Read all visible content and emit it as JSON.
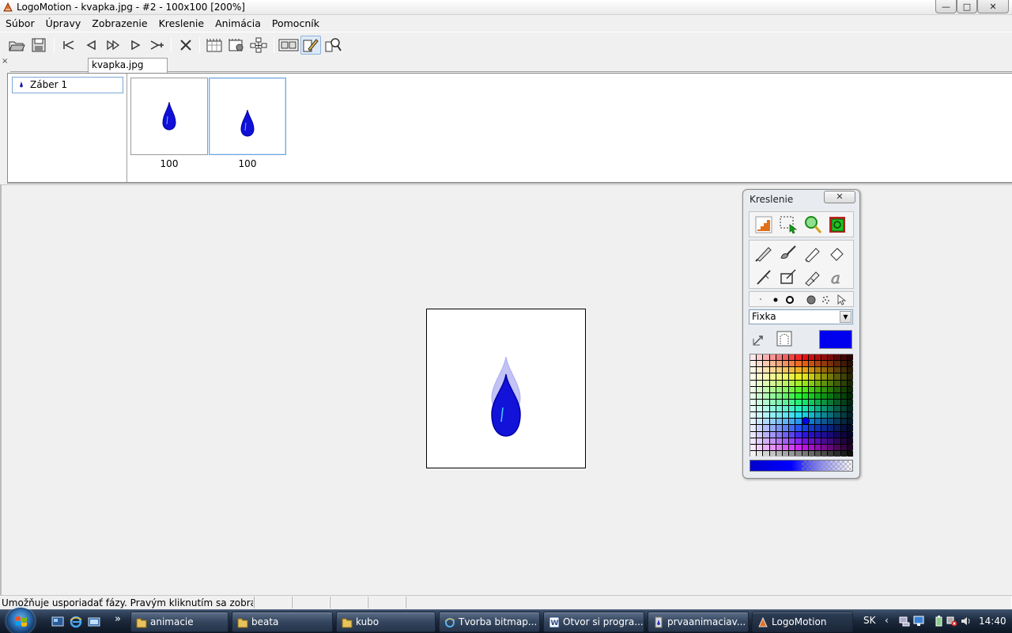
{
  "window": {
    "title": "LogoMotion - kvapka.jpg - #2 - 100x100 [200%]",
    "minimize_label": "—",
    "maximize_label": "□",
    "close_label": "✕"
  },
  "menubar": {
    "items": [
      "Súbor",
      "Úpravy",
      "Zobrazenie",
      "Kreslenie",
      "Animácia",
      "Pomocník"
    ]
  },
  "toolbar": {
    "icons": [
      "open-icon",
      "save-icon",
      "first-frame-icon",
      "prev-frame-icon",
      "next-frames-icon",
      "play-icon",
      "last-frame-icon",
      "delete-frame-icon",
      "frame-grid-icon",
      "frame-image-icon",
      "move-icon",
      "frames-view-icon",
      "draw-icon",
      "zoom-icon"
    ]
  },
  "tabs": {
    "close_label": "×",
    "active_tab": "kvapka.jpg"
  },
  "scenes": {
    "items": [
      {
        "label": "Záber 1"
      }
    ]
  },
  "frames": [
    {
      "label": "100",
      "selected": false
    },
    {
      "label": "100",
      "selected": true
    }
  ],
  "drawing_panel": {
    "title": "Kreslenie",
    "close_label": "✕",
    "brush_type": "Fixka",
    "current_color": "#0000ee",
    "dropdown_arrow": "▼"
  },
  "statusbar": {
    "text": "Umožňuje usporiadať fázy. Pravým kliknutím sa zobrazí ďalš"
  },
  "taskbar": {
    "buttons": [
      {
        "label": "animacie",
        "icon": "folder-icon",
        "active": false
      },
      {
        "label": "beata",
        "icon": "folder-icon",
        "active": false
      },
      {
        "label": "kubo",
        "icon": "folder-icon",
        "active": false
      },
      {
        "label": "Tvorba bitmap...",
        "icon": "ie-icon",
        "active": false
      },
      {
        "label": "Otvor si progra...",
        "icon": "word-icon",
        "active": false
      },
      {
        "label": "prvaanimaciav...",
        "icon": "logomotion-file-icon",
        "active": false
      },
      {
        "label": "LogoMotion",
        "icon": "logomotion-icon",
        "active": true
      }
    ],
    "language": "SK",
    "clock": "14:40",
    "more_label": "»"
  }
}
